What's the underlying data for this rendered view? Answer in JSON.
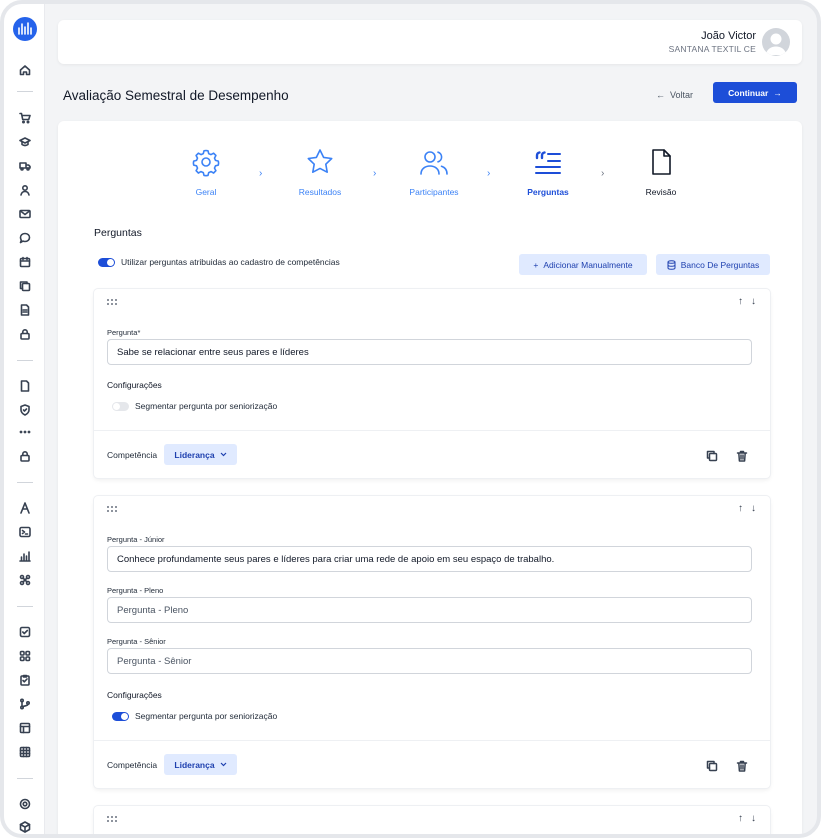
{
  "header": {
    "user_name": "João Victor",
    "company": "SANTANA TEXTIL CE"
  },
  "page": {
    "title": "Avaliação Semestral de Desempenho",
    "back_label": "Voltar",
    "continue_label": "Continuar"
  },
  "stepper": {
    "steps": [
      {
        "label": "Geral",
        "icon": "gear-icon",
        "state": "done"
      },
      {
        "label": "Resultados",
        "icon": "star-icon",
        "state": "done"
      },
      {
        "label": "Participantes",
        "icon": "users-icon",
        "state": "done"
      },
      {
        "label": "Perguntas",
        "icon": "quote-list-icon",
        "state": "active"
      },
      {
        "label": "Revisão",
        "icon": "document-icon",
        "state": "todo"
      }
    ]
  },
  "questions": {
    "section_title": "Perguntas",
    "use_competency_questions_label": "Utilizar perguntas atribuidas ao cadastro de competências",
    "use_competency_questions_on": true,
    "add_manual_label": "Adicionar Manualmente",
    "question_bank_label": "Banco De Perguntas",
    "configs_label": "Configurações",
    "segment_label": "Segmentar pergunta por seniorização",
    "competency_label": "Competência",
    "cards": [
      {
        "segmented": false,
        "question_label": "Pergunta*",
        "question_value": "Sabe se relacionar entre seus pares e líderes",
        "competency": "Liderança"
      },
      {
        "segmented": true,
        "junior_label": "Pergunta - Júnior",
        "junior_value": "Conhece profundamente seus pares e líderes para criar uma rede de apoio em seu espaço de trabalho.",
        "pleno_label": "Pergunta - Pleno",
        "pleno_placeholder": "Pergunta - Pleno",
        "senior_label": "Pergunta - Sênior",
        "senior_placeholder": "Pergunta - Sênior",
        "competency": "Liderança"
      }
    ]
  },
  "colors": {
    "primary": "#1d4ed8",
    "step_done": "#3b82f6",
    "soft_button": "#e0eaff"
  }
}
